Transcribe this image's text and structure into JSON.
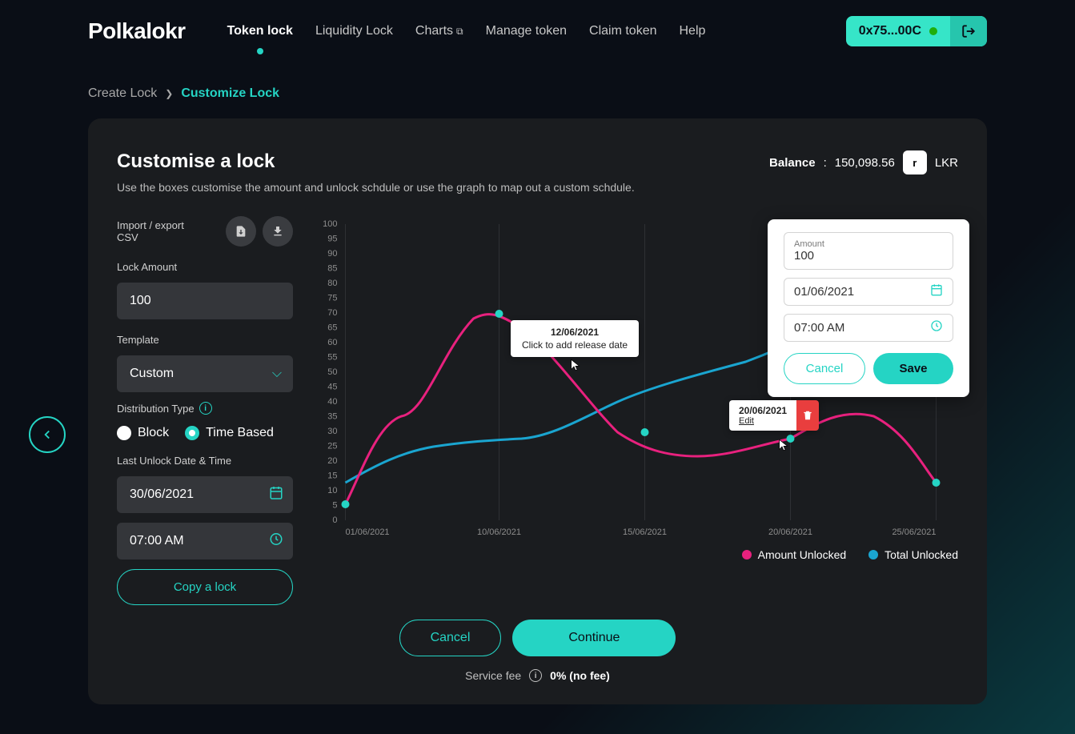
{
  "brand": "Polkalokr",
  "nav": {
    "token_lock": "Token lock",
    "liquidity_lock": "Liquidity Lock",
    "charts": "Charts",
    "manage_token": "Manage token",
    "claim_token": "Claim token",
    "help": "Help"
  },
  "wallet": {
    "address": "0x75...00C"
  },
  "breadcrumb": {
    "prev": "Create Lock",
    "current": "Customize Lock"
  },
  "header": {
    "title": "Customise a lock",
    "desc": "Use the boxes customise the amount and unlock schdule or use the graph to map out a custom schdule.",
    "balance_label": "Balance",
    "balance_value": "150,098.56",
    "token_symbol": "LKR"
  },
  "sidebar": {
    "csv_label": "Import / export CSV",
    "lock_amount_label": "Lock Amount",
    "lock_amount_value": "100",
    "template_label": "Template",
    "template_value": "Custom",
    "distribution_label": "Distribution Type",
    "block_label": "Block",
    "time_label": "Time Based",
    "last_unlock_label": "Last Unlock Date & Time",
    "last_date": "30/06/2021",
    "last_time": "07:00 AM",
    "copy_lock": "Copy a lock"
  },
  "tooltip_add": {
    "date": "12/06/2021",
    "hint": "Click to add release date"
  },
  "tooltip_edit": {
    "date": "20/06/2021",
    "edit": "Edit"
  },
  "popup": {
    "amount_label": "Amount",
    "amount_value": "100",
    "date_value": "01/06/2021",
    "time_value": "07:00 AM",
    "cancel": "Cancel",
    "save": "Save"
  },
  "legend": {
    "pink": "Amount Unlocked",
    "blue": "Total Unlocked"
  },
  "footer": {
    "cancel": "Cancel",
    "continue": "Continue",
    "service_fee_label": "Service fee",
    "service_fee_value": "0% (no fee)"
  },
  "chart_data": {
    "type": "line",
    "xlabel": "",
    "ylabel": "",
    "ylim": [
      0,
      100
    ],
    "y_ticks": [
      0,
      5,
      10,
      15,
      20,
      25,
      30,
      35,
      40,
      45,
      50,
      55,
      60,
      65,
      70,
      75,
      80,
      85,
      90,
      95,
      100
    ],
    "x_ticks": [
      "01/06/2021",
      "10/06/2021",
      "15/06/2021",
      "20/06/2021",
      "25/06/2021"
    ],
    "series": [
      {
        "name": "Amount Unlocked",
        "color": "#e8217e",
        "points": [
          {
            "x": "01/06/2021",
            "y": 5
          },
          {
            "x": "04/06/2021",
            "y": 35
          },
          {
            "x": "08/06/2021",
            "y": 65
          },
          {
            "x": "10/06/2021",
            "y": 70
          },
          {
            "x": "12/06/2021",
            "y": 60
          },
          {
            "x": "15/06/2021",
            "y": 30
          },
          {
            "x": "18/06/2021",
            "y": 22
          },
          {
            "x": "20/06/2021",
            "y": 28
          },
          {
            "x": "22/06/2021",
            "y": 38
          },
          {
            "x": "25/06/2021",
            "y": 13
          }
        ]
      },
      {
        "name": "Total Unlocked",
        "color": "#1aa5d0",
        "points": [
          {
            "x": "01/06/2021",
            "y": 13
          },
          {
            "x": "05/06/2021",
            "y": 25
          },
          {
            "x": "10/06/2021",
            "y": 28
          },
          {
            "x": "14/06/2021",
            "y": 40
          },
          {
            "x": "18/06/2021",
            "y": 50
          },
          {
            "x": "22/06/2021",
            "y": 70
          },
          {
            "x": "25/06/2021",
            "y": 95
          }
        ]
      }
    ],
    "markers": [
      {
        "x": "01/06/2021",
        "y": 5
      },
      {
        "x": "10/06/2021",
        "y": 70
      },
      {
        "x": "15/06/2021",
        "y": 30
      },
      {
        "x": "20/06/2021",
        "y": 28
      },
      {
        "x": "25/06/2021",
        "y": 13
      }
    ]
  },
  "colors": {
    "accent": "#25d4c4",
    "pink": "#e8217e",
    "blue": "#1aa5d0",
    "danger": "#e93e3e"
  }
}
